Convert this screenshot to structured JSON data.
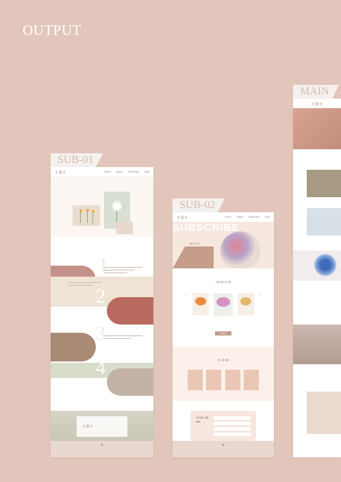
{
  "heading": "OUTPUT",
  "tags": {
    "sub01": "SUB-01",
    "sub02": "SUB-02",
    "main": "MAIN"
  },
  "sub01": {
    "logo": "ㅎ꽃ㅎ",
    "nav": [
      "Home",
      "About",
      "Subscribe",
      "Q&A"
    ],
    "steps": [
      "1",
      "2",
      "3",
      "4"
    ],
    "bottom_banner_text": "ㅎ꽃ㅎ"
  },
  "sub02": {
    "logo": "ㅎ꽃ㅎ",
    "nav": [
      "Home",
      "About",
      "Subscribe",
      "Q&A"
    ],
    "hero_word": "SUBSCRIBE",
    "hero_caption": "생화 꽃 구독",
    "section_title": "이번 달의 꽃 구독",
    "button": "구독하기",
    "process_title": "꽃 구독 방법",
    "faq_title": "FAQ",
    "faq_sub": "자주 묻는 질문"
  },
  "main": {
    "logo": "ㅎ꽃ㅎ"
  },
  "colors": {
    "background": "#e3c6bb",
    "accent": "#c49a88",
    "light": "#f4e8df",
    "sage": "#d7dccd",
    "tag_bg": "#f4f1ee",
    "tag_text": "#d9b8ab"
  }
}
